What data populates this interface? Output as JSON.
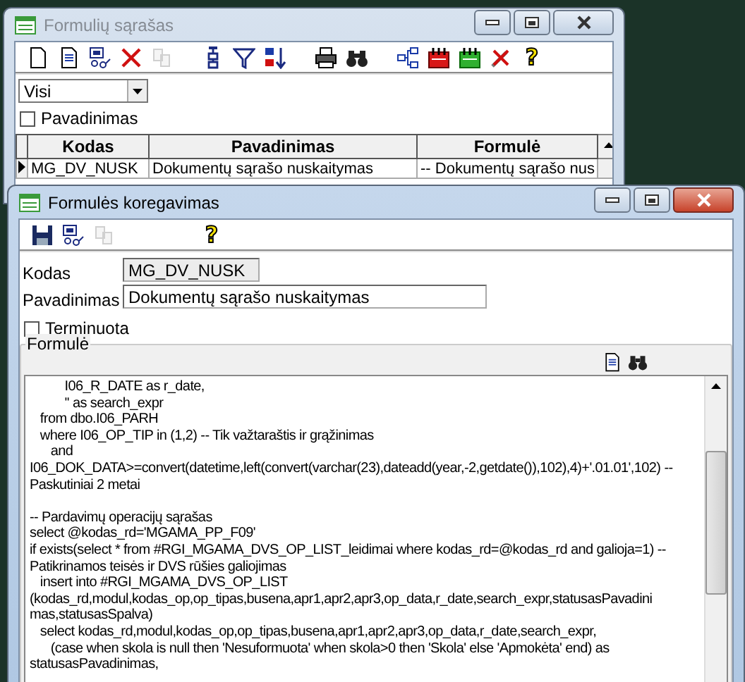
{
  "windows": [
    {
      "title": "Formulių sąrašas",
      "active": false,
      "toolbar": [
        [
          {
            "kind": "new",
            "disabled": false
          },
          {
            "kind": "edit",
            "disabled": false
          },
          {
            "kind": "link-edit",
            "disabled": false
          },
          {
            "kind": "delete",
            "disabled": false
          },
          {
            "kind": "copy",
            "disabled": true
          }
        ],
        [
          {
            "kind": "tree",
            "disabled": false
          },
          {
            "kind": "filter",
            "disabled": false
          },
          {
            "kind": "sort",
            "disabled": false
          }
        ],
        [
          {
            "kind": "print",
            "disabled": false
          },
          {
            "kind": "find",
            "disabled": false
          }
        ],
        [
          {
            "kind": "network",
            "disabled": false
          },
          {
            "kind": "cal-red",
            "disabled": false
          },
          {
            "kind": "cal-green",
            "disabled": false
          },
          {
            "kind": "tools-x",
            "disabled": false
          },
          {
            "kind": "help",
            "disabled": false,
            "label": "?"
          }
        ]
      ],
      "filter": {
        "value": "Visi"
      },
      "checkbox": {
        "label": "Pavadinimas",
        "checked": false
      },
      "table": {
        "columns": [
          "Kodas",
          "Pavadinimas",
          "Formulė"
        ],
        "rows": [
          {
            "selected": true,
            "cells": [
              "MG_DV_NUSK",
              "Dokumentų sąrašo nuskaitymas",
              "-- Dokumentų sąrašo nus"
            ]
          }
        ]
      }
    },
    {
      "title": "Formulės koregavimas",
      "active": true,
      "toolbar": [
        [
          {
            "kind": "save",
            "disabled": false
          },
          {
            "kind": "link-edit",
            "disabled": false
          },
          {
            "kind": "copy",
            "disabled": true
          }
        ],
        [
          {
            "kind": "help",
            "disabled": false,
            "label": "?"
          }
        ]
      ],
      "fields": [
        {
          "label": "Kodas",
          "value": "MG_DV_NUSK",
          "readonly": true
        },
        {
          "label": "Pavadinimas",
          "value": "Dokumentų sąrašo nuskaitymas",
          "readonly": false
        }
      ],
      "checkbox": {
        "label": "Terminuota",
        "checked": false
      },
      "formula": {
        "title": "Formulė",
        "lines": [
          {
            "kind": "code",
            "text": "          I06_R_DATE as r_date,"
          },
          {
            "kind": "code",
            "text": "          '' as search_expr"
          },
          {
            "kind": "code",
            "text": "   from dbo.I06_PARH"
          },
          {
            "kind": "code",
            "text": "   where I06_OP_TIP in (1,2) -- Tik važtaraštis ir grąžinimas"
          },
          {
            "kind": "code",
            "text": "      and"
          },
          {
            "kind": "code",
            "text": "I06_DOK_DATA>=convert(datetime,left(convert(varchar(23),dateadd(year,-2,getdate()),102),4)+'.01.01',102) --"
          },
          {
            "kind": "code",
            "text": "Paskutiniai 2 metai"
          },
          {
            "kind": "blank"
          },
          {
            "kind": "code",
            "text": "-- Pardavimų operacijų sąrašas"
          },
          {
            "kind": "code",
            "text": "select @kodas_rd='MGAMA_PP_F09'"
          },
          {
            "kind": "code",
            "text": "if exists(select * from #RGI_MGAMA_DVS_OP_LIST_leidimai where kodas_rd=@kodas_rd and galioja=1) --"
          },
          {
            "kind": "code",
            "text": "Patikrinamos teisės ir DVS rūšies galiojimas"
          },
          {
            "kind": "code",
            "text": "   insert into #RGI_MGAMA_DVS_OP_LIST"
          },
          {
            "kind": "code",
            "text": "(kodas_rd,modul,kodas_op,op_tipas,busena,apr1,apr2,apr3,op_data,r_date,search_expr,statusasPavadini"
          },
          {
            "kind": "code",
            "text": "mas,statusasSpalva)"
          },
          {
            "kind": "code",
            "text": "   select kodas_rd,modul,kodas_op,op_tipas,busena,apr1,apr2,apr3,op_data,r_date,search_expr,"
          },
          {
            "kind": "code",
            "text": "      (case when skola is null then 'Nesuformuota' when skola>0 then 'Skola' else 'Apmokėta' end) as"
          },
          {
            "kind": "code",
            "text": "statusasPavadinimas,"
          }
        ]
      }
    }
  ]
}
